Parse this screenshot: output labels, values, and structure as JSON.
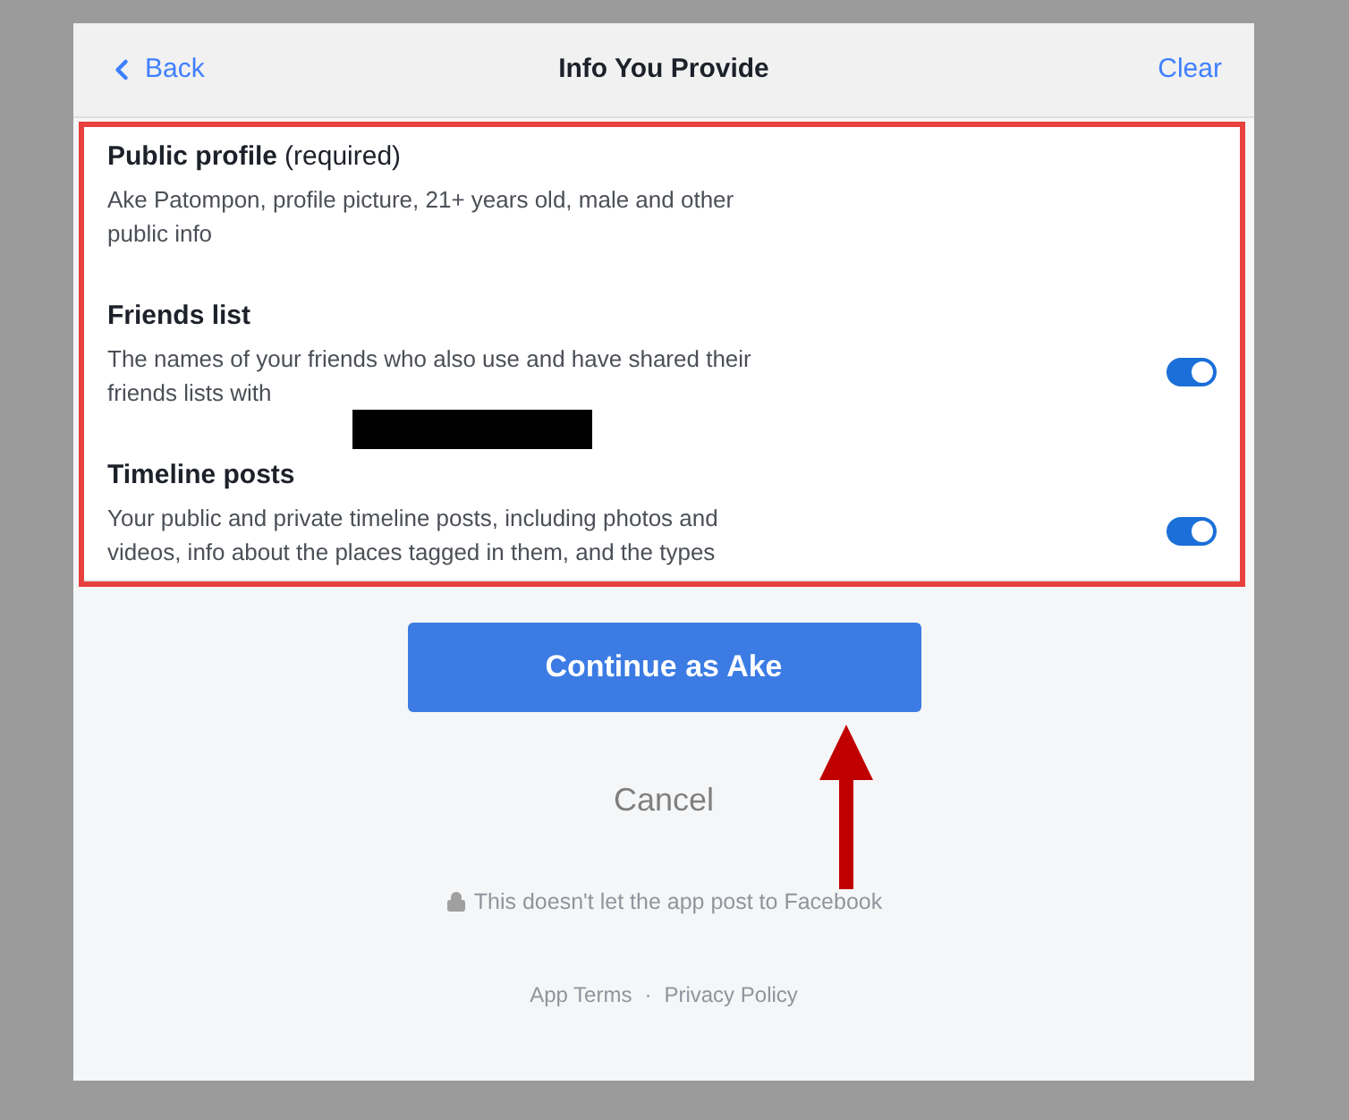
{
  "header": {
    "back": "Back",
    "title": "Info You Provide",
    "clear": "Clear"
  },
  "permissions": [
    {
      "kind": "required",
      "title": "Public profile",
      "note": "(required)",
      "description": "Ake Patompon, profile picture, 21+ years old, male and other public info"
    },
    {
      "kind": "toggle",
      "title": "Friends list",
      "description": "The names of your friends who also use and have shared their friends lists with",
      "redacted": true,
      "on": true
    },
    {
      "kind": "toggle",
      "title": "Timeline posts",
      "description": "Your public and private timeline posts, including photos and videos, info about the places tagged in them, and the types",
      "redacted": false,
      "on": true
    }
  ],
  "continue_button": "Continue as Ake",
  "cancel": "Cancel",
  "notice": "This doesn't let the app post to Facebook",
  "footer_links": [
    "App Terms",
    "Privacy Policy"
  ],
  "footer_separator": "·"
}
